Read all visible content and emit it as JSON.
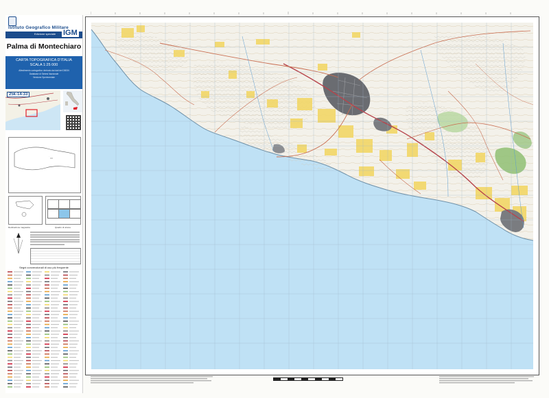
{
  "publisher": {
    "name": "Istituto Geografico Militare",
    "edition_label": "Edizione speciale",
    "logo_text": "IGM"
  },
  "sheet": {
    "title": "Palma di Montechiaro",
    "code": "25k-14-33",
    "series_line1": "CARTA TOPOGRAFICA D'ITALIA",
    "series_line2": "SCALA 1:25 000",
    "series_small": [
      "Allestimento cartografico derivato dai dati del DBGN",
      "Database di Sintesi Nazionale",
      "Versione Sperimentale"
    ]
  },
  "legend": {
    "title": "Segni convenzionali di uso più frequente",
    "declination_caption": "Declinazione magnetica",
    "region_caption": "Quadro di unione"
  },
  "colors": {
    "sea": "#bfe1f5",
    "land": "#f3f1ea",
    "relief": "#d6d4cc",
    "agriculture": "#f2d767",
    "urban": "#5f6166",
    "roads": "#b7434b",
    "panel_blue": "#1f62ad",
    "igm_blue": "#1b4c8c",
    "forest": "#8fbf73"
  },
  "icons": [
    "igm-emblem-icon",
    "compass-rose-icon",
    "qr-code-icon"
  ]
}
